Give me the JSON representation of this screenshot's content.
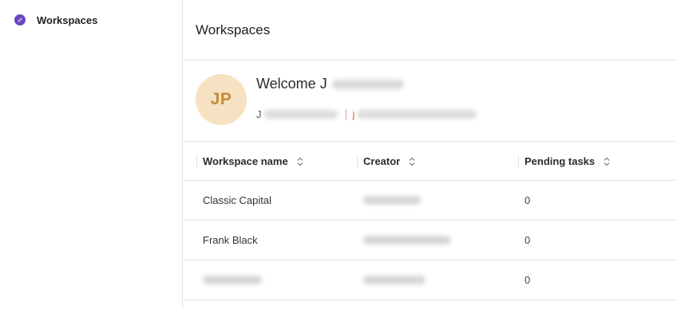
{
  "sidebar": {
    "items": [
      {
        "label": "Workspaces",
        "icon": "compass-icon",
        "active": true
      }
    ]
  },
  "page": {
    "title": "Workspaces"
  },
  "welcome": {
    "greeting": "Welcome J",
    "avatar_initials": "JP",
    "sub_prefix": "J",
    "email_prefix": "j"
  },
  "table": {
    "columns": [
      {
        "label": "Workspace name"
      },
      {
        "label": "Creator"
      },
      {
        "label": "Pending tasks"
      }
    ],
    "rows": [
      {
        "name": "Classic Capital",
        "creator": "",
        "pending": "0"
      },
      {
        "name": "Frank Black",
        "creator": "",
        "pending": "0"
      },
      {
        "name": "",
        "creator": "",
        "pending": "0"
      }
    ]
  },
  "colors": {
    "accent": "#6b46c1",
    "avatar_bg": "#f6e2c2",
    "avatar_fg": "#c98a37"
  }
}
